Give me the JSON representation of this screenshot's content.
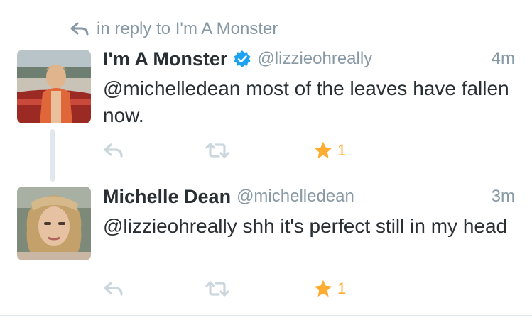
{
  "context": {
    "reply_text": "in reply to I'm A Monster"
  },
  "tweets": [
    {
      "name": "I'm A Monster",
      "verified": true,
      "handle": "@lizzieohreally",
      "time": "4m",
      "text": "@michelledean most of the leaves have fallen now.",
      "favorites": "1"
    },
    {
      "name": "Michelle Dean",
      "verified": false,
      "handle": "@michelledean",
      "time": "3m",
      "text": "@lizzieohreally shh it's perfect still in my head",
      "favorites": "1"
    }
  ],
  "colors": {
    "secondary": "#8899a6",
    "verified": "#1da1f2",
    "favorite": "#ffac33",
    "divider": "#e1e8ed"
  },
  "icons": [
    "reply-icon",
    "verified-icon",
    "retweet-icon",
    "favorite-star-icon"
  ]
}
